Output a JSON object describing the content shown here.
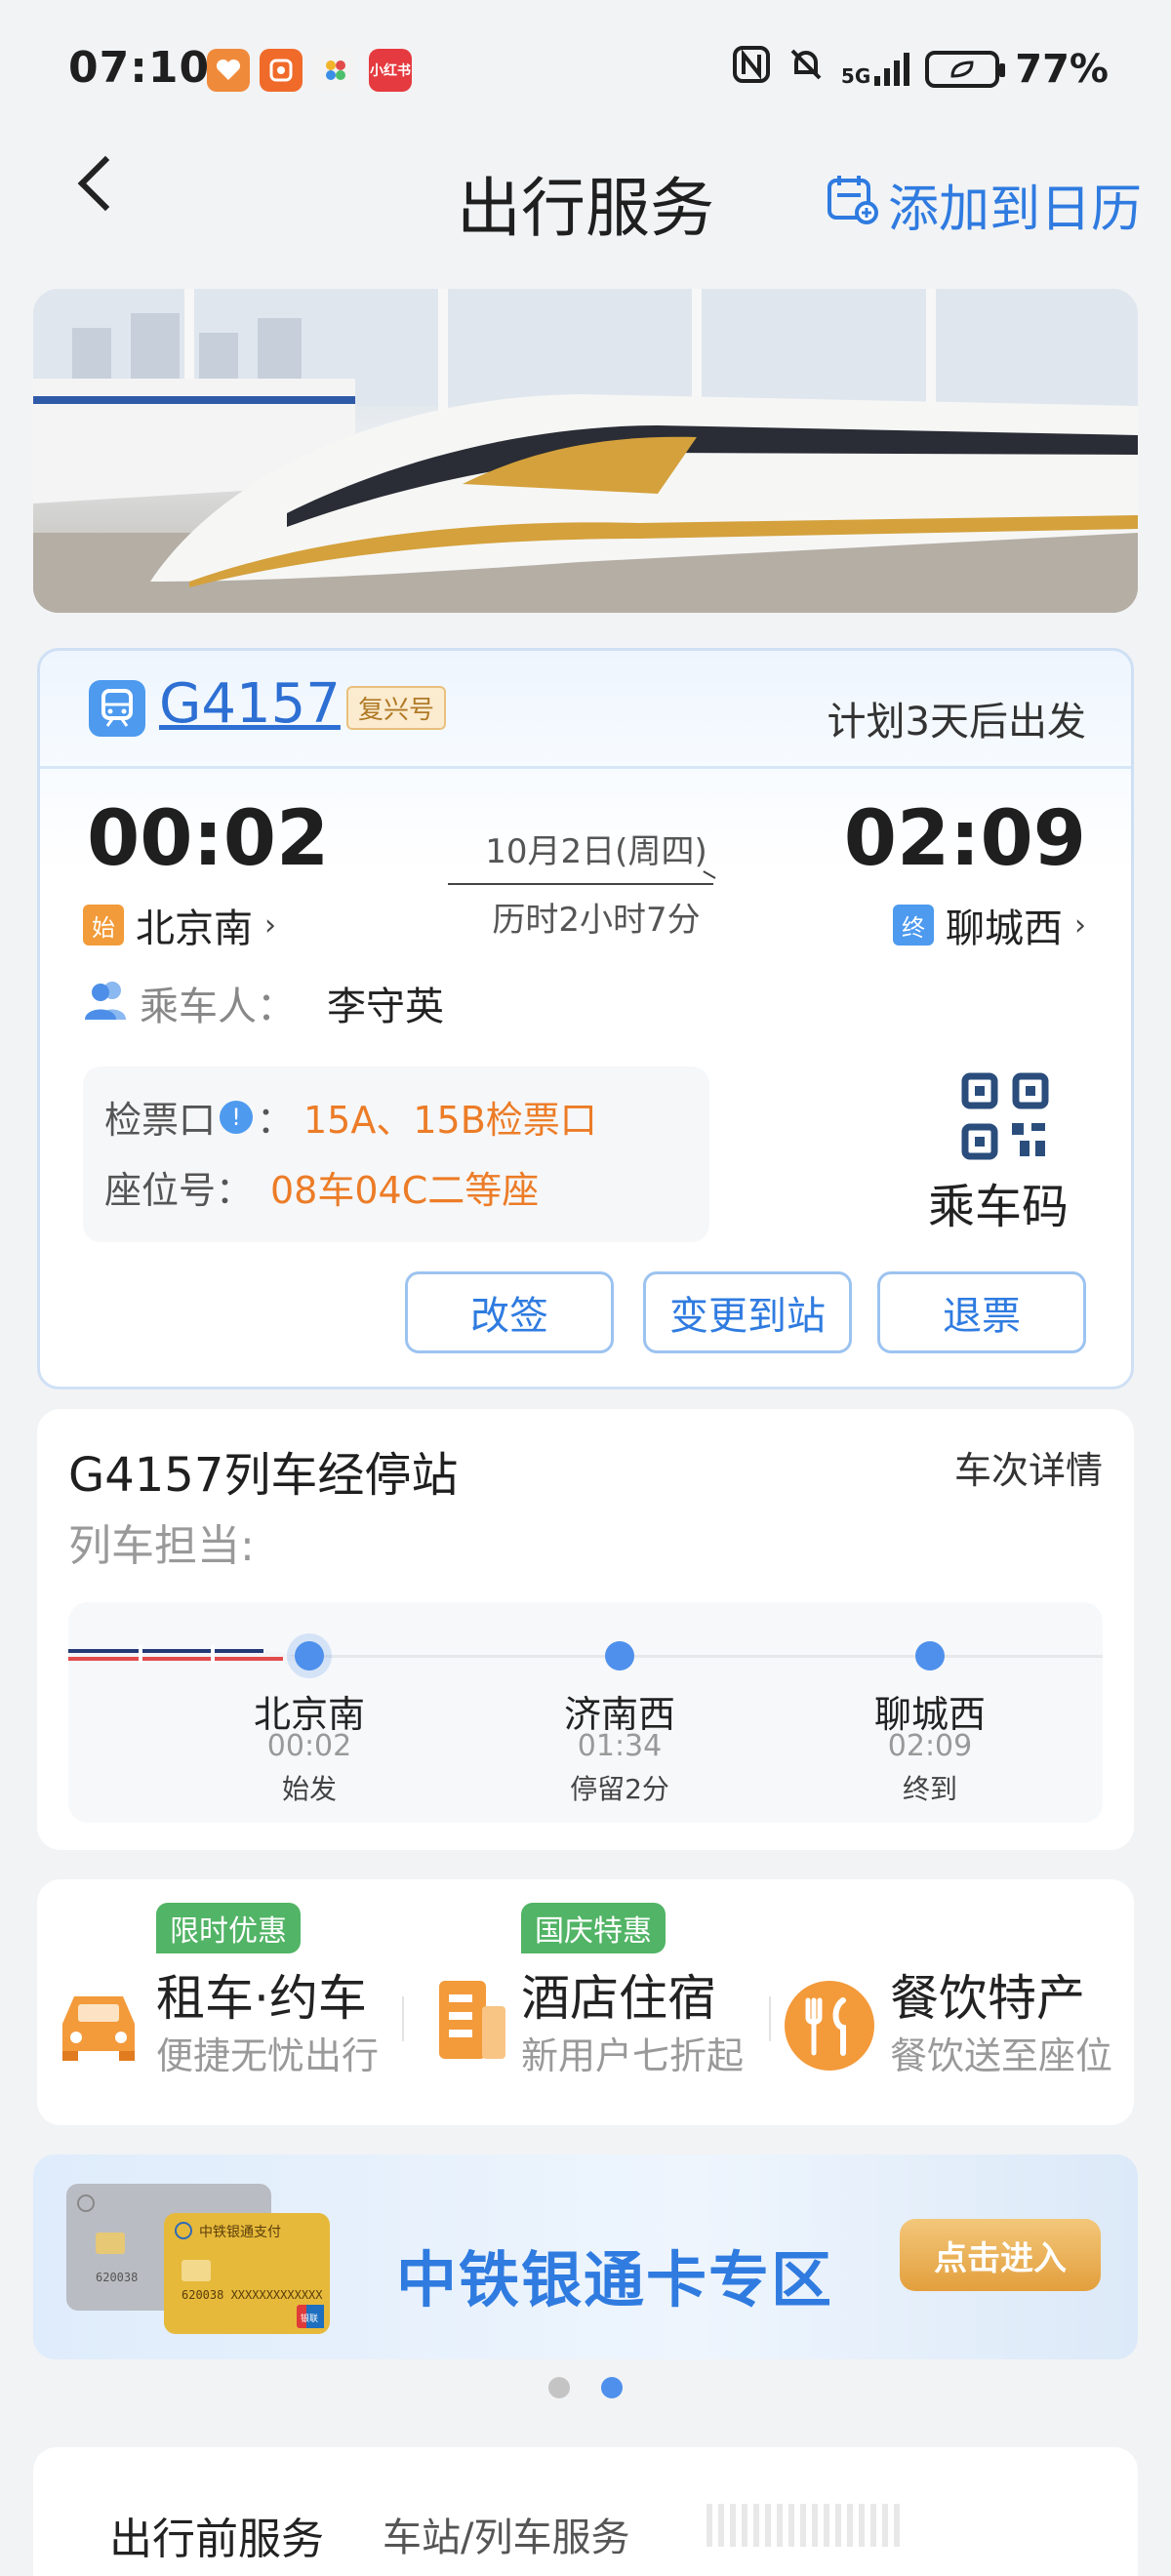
{
  "status_bar": {
    "time": "07:10",
    "network": "5G",
    "battery": "77%",
    "app_icons": [
      "heart-app-icon",
      "video-app-icon",
      "flower-app-icon",
      "xiaohongshu-app-icon"
    ],
    "app_icon_colors": [
      "#f08a3b",
      "#f06a2a",
      "#f3f3f3",
      "#e53a3f"
    ],
    "app_icon_texts": [
      "",
      "",
      "",
      "小红书"
    ]
  },
  "header": {
    "title": "出行服务",
    "add_calendar": "添加到日历",
    "accent": "#2f7be0"
  },
  "ticket": {
    "train_no": "G4157",
    "train_type": "复兴号",
    "plan_text": "计划3天后出发",
    "departure": {
      "time": "00:02",
      "tag": "始",
      "station": "北京南"
    },
    "arrival": {
      "time": "02:09",
      "tag": "终",
      "station": "聊城西"
    },
    "date": "10月2日(周四)",
    "duration": "历时2小时7分",
    "passenger_label": "乘车人：",
    "passenger_name": "李守英",
    "gate_label": "检票口",
    "gate_colon": "：",
    "gate_value": "15A、15B检票口",
    "seat_label": "座位号：",
    "seat_value": "08车04C二等座",
    "qr_label": "乘车码",
    "buttons": [
      "改签",
      "变更到站",
      "退票"
    ],
    "highlight_color": "#ec7c27"
  },
  "stops": {
    "title": "G4157列车经停站",
    "detail_link": "车次详情",
    "subtitle": "列车担当:",
    "items": [
      {
        "name": "北京南",
        "time": "00:02",
        "note": "始发"
      },
      {
        "name": "济南西",
        "time": "01:34",
        "note": "停留2分"
      },
      {
        "name": "聊城西",
        "time": "02:09",
        "note": "终到"
      }
    ]
  },
  "services": [
    {
      "badge": "限时优惠",
      "title": "租车·约车",
      "subtitle": "便捷无忧出行",
      "icon": "car-icon"
    },
    {
      "badge": "国庆特惠",
      "title": "酒店住宿",
      "subtitle": "新用户七折起",
      "icon": "hotel-icon"
    },
    {
      "badge": "",
      "title": "餐饮特产",
      "subtitle": "餐饮送至座位",
      "icon": "dining-icon"
    }
  ],
  "card_banner": {
    "title": "中铁银通卡专区",
    "button": "点击进入",
    "card_text": "中铁银通支付",
    "card_number": "620038",
    "card_number_long": "620038 XXXXXXXXXXXXX",
    "union_text": "银联"
  },
  "pagination": {
    "total": 2,
    "active": 2
  },
  "bottom_tabs": [
    "出行前服务",
    "车站/列车服务"
  ]
}
